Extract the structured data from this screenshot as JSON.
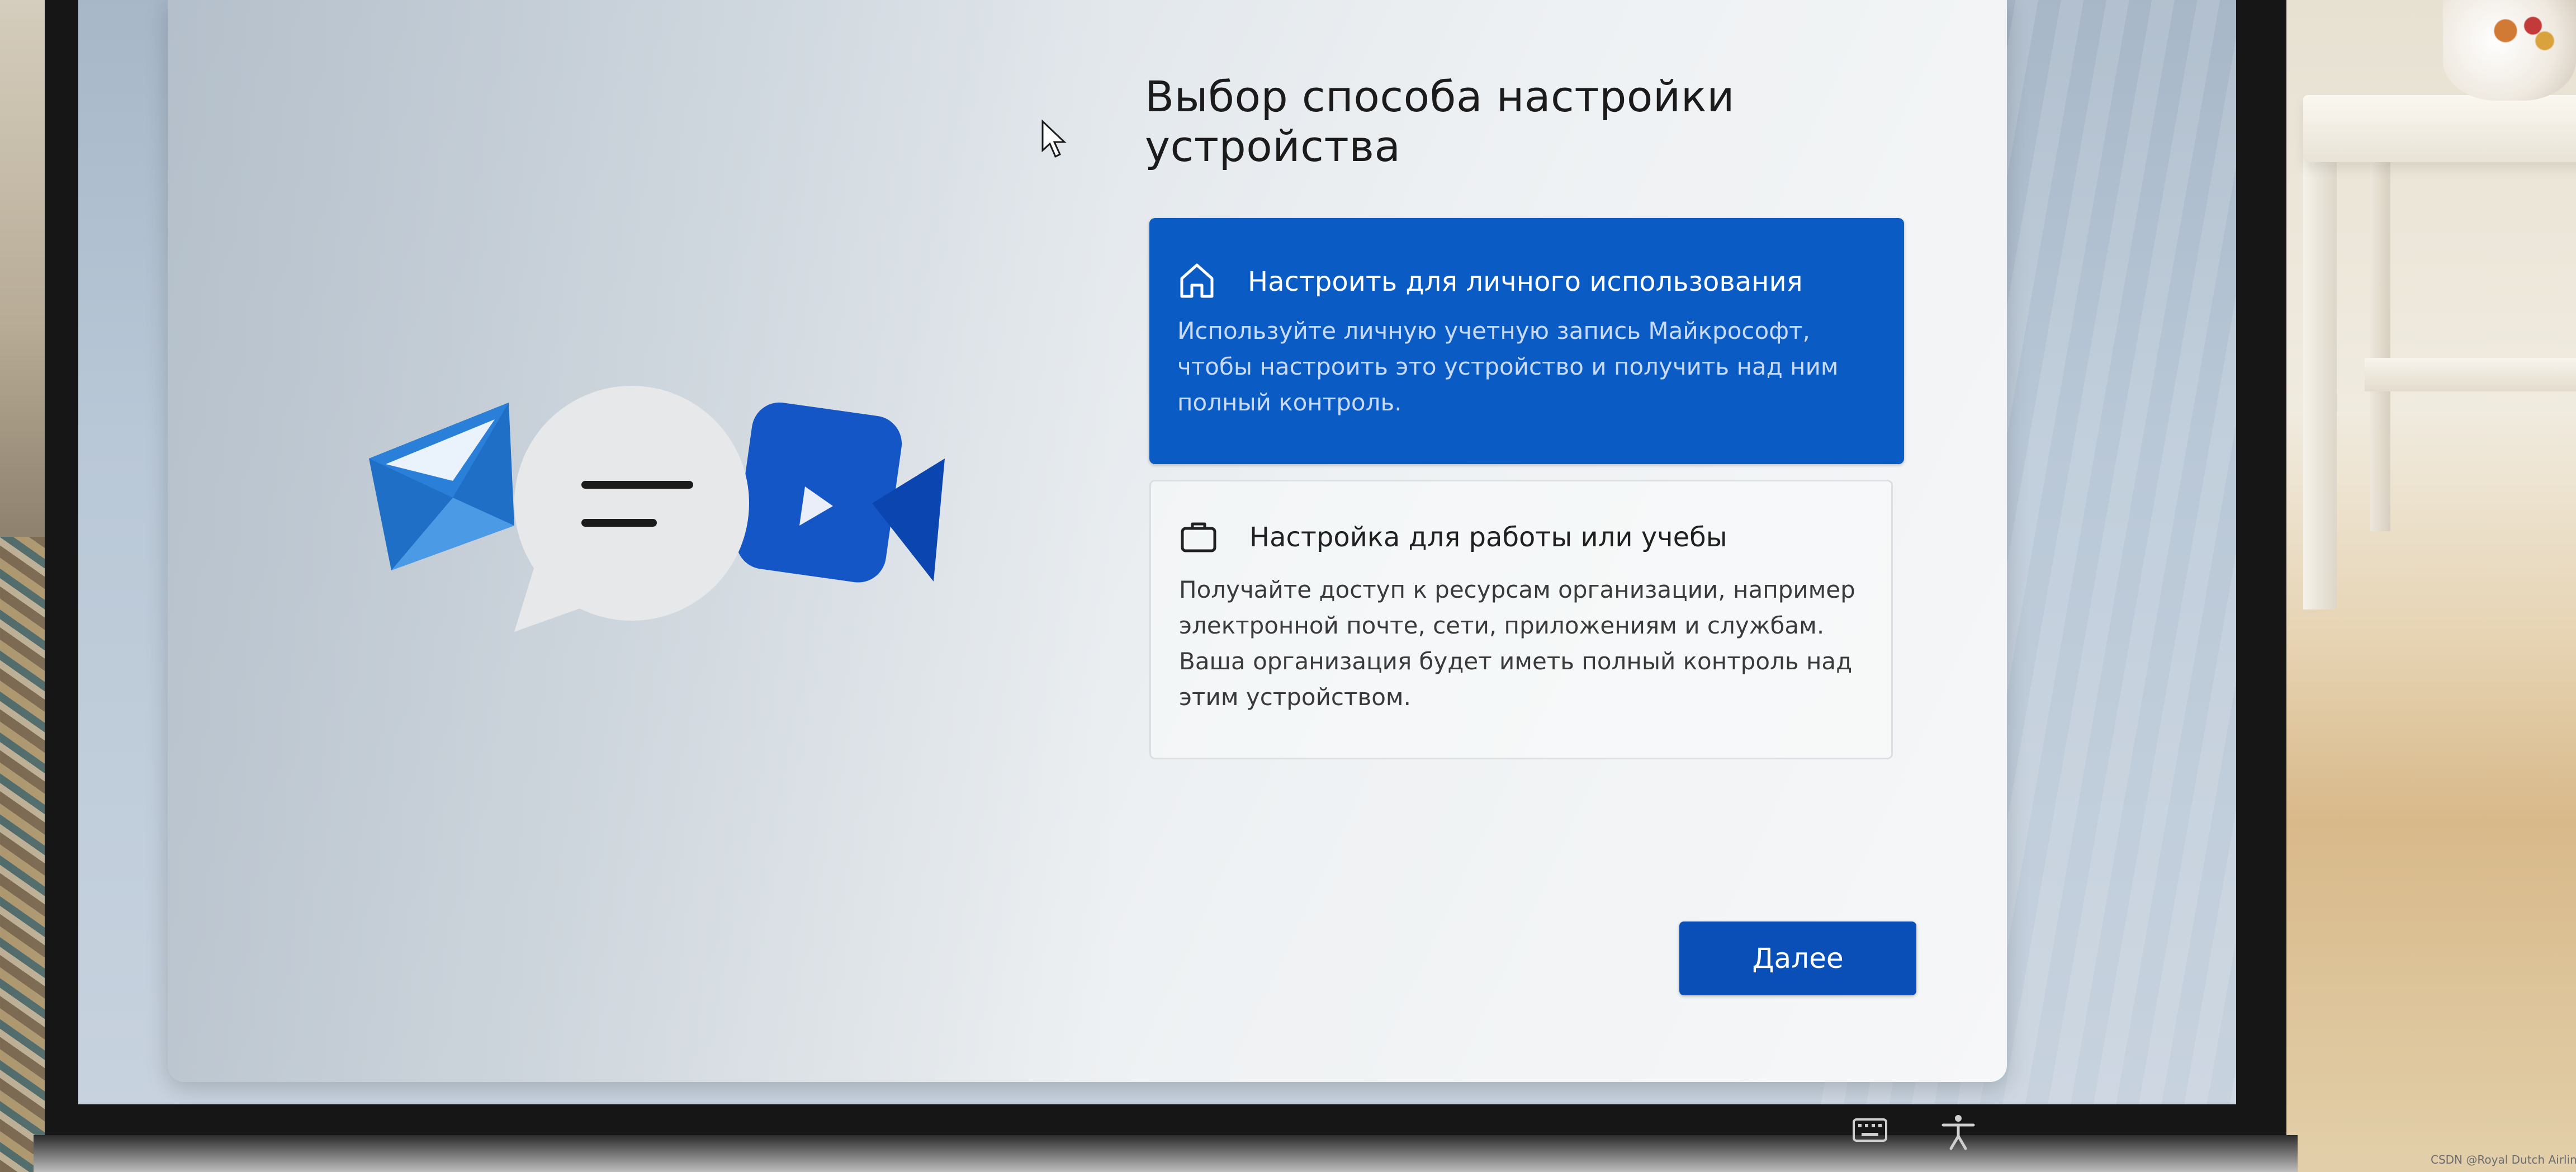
{
  "page": {
    "title": "Выбор способа настройки устройства"
  },
  "options": [
    {
      "icon": "home-icon",
      "title": "Настроить для личного использования",
      "description": "Используйте личную учетную запись Майкрософт, чтобы настроить это устройство и получить над ним полный контроль.",
      "selected": true
    },
    {
      "icon": "briefcase-icon",
      "title": "Настройка для работы или учебы",
      "description": "Получайте доступ к ресурсам организации, например электронной почте, сети, приложениям и службам. Ваша организация будет иметь полный контроль над этим устройством.",
      "selected": false
    }
  ],
  "actions": {
    "next_label": "Далее"
  },
  "accessibility": {
    "keyboard_icon": "keyboard-icon",
    "accessibility_icon": "accessibility-icon"
  },
  "watermark": "CSDN @Royal Dutch Airlines",
  "colors": {
    "accent": "#0a5bc4",
    "button": "#0a4fb8",
    "selected_text": "#ffffff",
    "selected_desc": "#c9dbf4"
  }
}
